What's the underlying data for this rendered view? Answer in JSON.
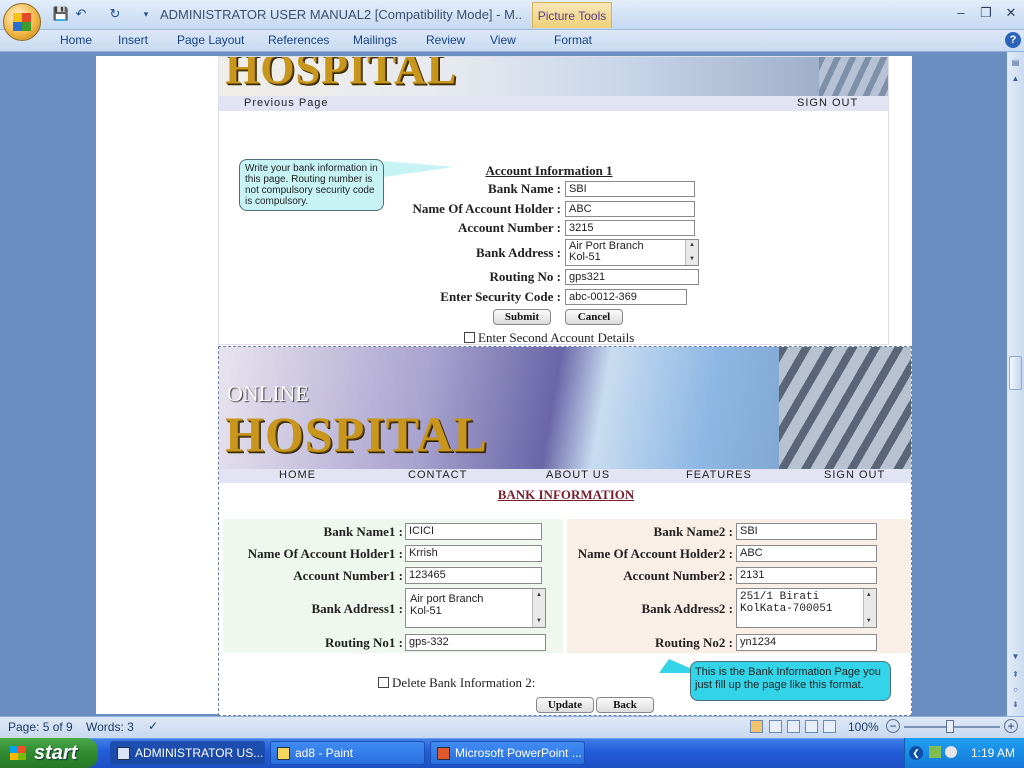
{
  "window": {
    "title": "ADMINISTRATOR USER MANUAL2 [Compatibility Mode] - M..",
    "contextual_tab": "Picture Tools",
    "minimize": "–",
    "restore": "❐",
    "close": "✕"
  },
  "qat": {
    "save": "💾",
    "undo": "↶",
    "redo": "↻",
    "more": "▾"
  },
  "ribbon": {
    "tabs": [
      "Home",
      "Insert",
      "Page Layout",
      "References",
      "Mailings",
      "Review",
      "View",
      "Format"
    ],
    "help": "?"
  },
  "shot1": {
    "banner_word": "HOSPITAL",
    "nav": {
      "left": "Previous Page",
      "right": "SIGN OUT"
    },
    "callout": "Write your bank information in this page. Routing number is not compulsory security code is compulsory.",
    "heading": "Account Information 1",
    "fields": [
      {
        "label": "Bank Name :",
        "value": "SBI"
      },
      {
        "label": "Name Of Account Holder :",
        "value": "ABC"
      },
      {
        "label": "Account Number :",
        "value": "3215"
      },
      {
        "label": "Bank Address :",
        "value": "Air Port Branch\nKol-51"
      },
      {
        "label": "Routing No :",
        "value": "gps321"
      },
      {
        "label": "Enter Security Code :",
        "value": "abc-0012-369"
      }
    ],
    "submit": "Submit",
    "cancel": "Cancel",
    "checkbox_label": "Enter Second Account Details"
  },
  "shot2": {
    "banner_small": "ONLINE",
    "banner_word": "HOSPITAL",
    "nav": [
      "HOME",
      "CONTACT",
      "ABOUT US",
      "FEATURES",
      "SIGN OUT"
    ],
    "heading": "BANK INFORMATION",
    "left": [
      {
        "label": "Bank Name1 :",
        "value": "ICICI"
      },
      {
        "label": "Name Of Account Holder1 :",
        "value": "Krrish"
      },
      {
        "label": "Account Number1 :",
        "value": "123465"
      },
      {
        "label": "Bank Address1 :",
        "value": "Air port Branch\nKol-51"
      },
      {
        "label": "Routing No1 :",
        "value": "gps-332"
      }
    ],
    "right": [
      {
        "label": "Bank Name2 :",
        "value": "SBI"
      },
      {
        "label": "Name Of Account Holder2 :",
        "value": "ABC"
      },
      {
        "label": "Account Number2 :",
        "value": "2131"
      },
      {
        "label": "Bank Address2 :",
        "value": "251/1 Birati\nKolKata-700051"
      },
      {
        "label": "Routing No2 :",
        "value": "yn1234"
      }
    ],
    "delete_label": "Delete Bank Information 2:",
    "callout": "This is the  Bank Information Page you just fill up the page like this format.",
    "update": "Update",
    "back": "Back"
  },
  "status": {
    "page": "Page: 5 of 9",
    "words": "Words: 3",
    "zoom": "100%",
    "zoom_out": "−",
    "zoom_in": "+"
  },
  "taskbar": {
    "start": "start",
    "items": [
      "ADMINISTRATOR US...",
      "ad8 - Paint",
      "Microsoft PowerPoint ..."
    ],
    "clock": "1:19 AM"
  },
  "colors": {
    "accent": "#15428b",
    "taskbar": "#245edb",
    "start": "#2f8a2f",
    "callout": "#c7f3f5"
  }
}
